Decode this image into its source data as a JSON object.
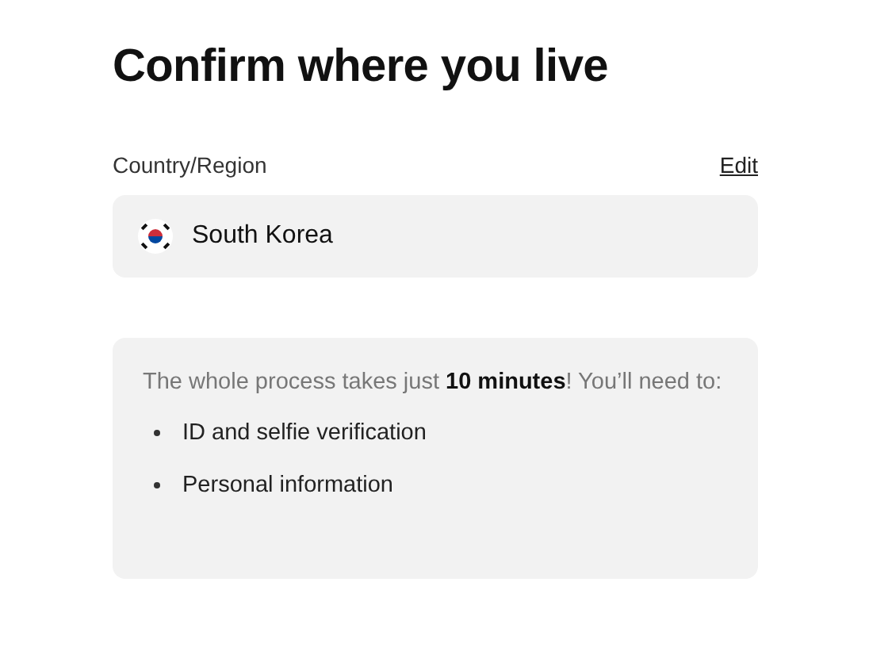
{
  "title": "Confirm where you live",
  "country": {
    "label": "Country/Region",
    "edit_link": "Edit",
    "value": "South Korea"
  },
  "info": {
    "text": "The whole process takes just **10 minutes**! You’ll need to:",
    "items": [
      "ID and selfie verification",
      "Personal information"
    ]
  }
}
